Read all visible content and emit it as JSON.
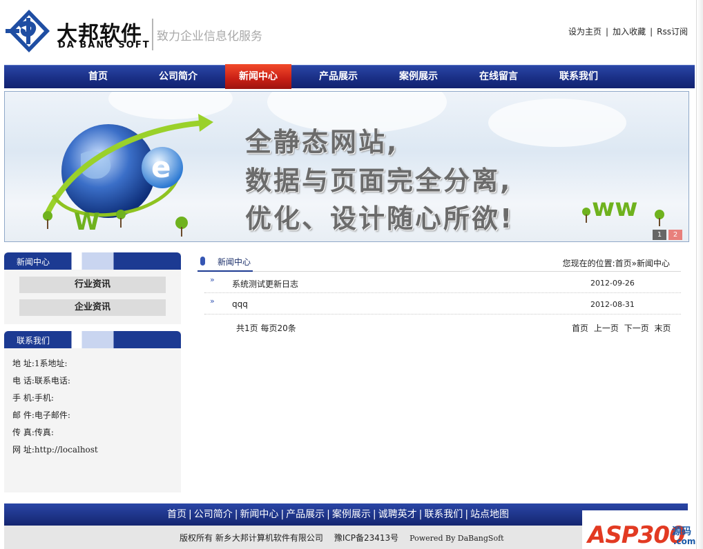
{
  "header": {
    "logo_cn": "大邦软件",
    "logo_en": "DA BANG SOFT",
    "slogan": "致力企业信息化服务",
    "top_links": [
      "设为主页",
      "加入收藏",
      "Rss订阅"
    ]
  },
  "nav": {
    "items": [
      "首页",
      "公司简介",
      "新闻中心",
      "产品展示",
      "案例展示",
      "在线留言",
      "联系我们"
    ],
    "active_index": 2
  },
  "banner": {
    "lines": [
      "全静态网站,",
      "数据与页面完全分离,",
      "优化、设计随心所欲!"
    ],
    "dots": [
      "1",
      "2"
    ],
    "active_dot": 1
  },
  "sidebar": {
    "news": {
      "title": "新闻中心",
      "items": [
        "行业资讯",
        "企业资讯"
      ]
    },
    "contact": {
      "title": "联系我们",
      "rows": [
        "地 址:1系地址:",
        "电 话:联系电话:",
        "手 机:手机:",
        "邮 件:电子邮件:",
        "传 真:传真:",
        "网 址:http://localhost"
      ]
    }
  },
  "content": {
    "title": "新闻中心",
    "breadcrumb": "您现在的位置:首页»新闻中心",
    "news": [
      {
        "title": "系统测试更新日志",
        "date": "2012-09-26"
      },
      {
        "title": "qqq",
        "date": "2012-08-31"
      }
    ],
    "pager_info": "共1页 每页20条",
    "pager_links": [
      "首页",
      "上一页",
      "下一页",
      "末页"
    ]
  },
  "footer": {
    "nav": [
      "首页",
      "公司简介",
      "新闻中心",
      "产品展示",
      "案例展示",
      "诚聘英才",
      "联系我们",
      "站点地图"
    ],
    "copyright": "版权所有 新乡大邦计算机软件有限公司",
    "icp": "豫ICP备23413号",
    "powered": "Powered By DaBangSoft"
  },
  "watermark": {
    "brand": "ASP300",
    "cn": "源码",
    "com": ".com"
  },
  "colors": {
    "nav_blue": "#1a2f86",
    "nav_active": "#c81f15",
    "slogan_gray": "#a8a8a8"
  }
}
